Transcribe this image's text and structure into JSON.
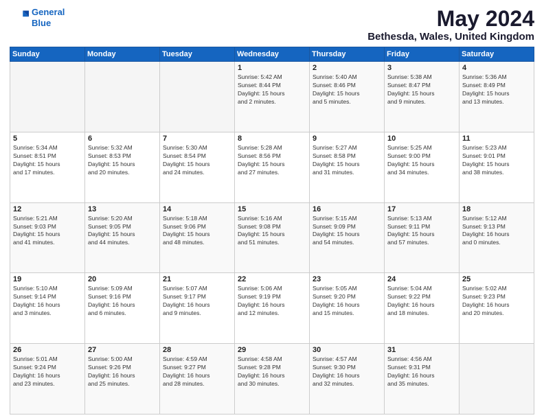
{
  "header": {
    "logo_line1": "General",
    "logo_line2": "Blue",
    "main_title": "May 2024",
    "subtitle": "Bethesda, Wales, United Kingdom"
  },
  "weekdays": [
    "Sunday",
    "Monday",
    "Tuesday",
    "Wednesday",
    "Thursday",
    "Friday",
    "Saturday"
  ],
  "weeks": [
    [
      {
        "day": "",
        "detail": ""
      },
      {
        "day": "",
        "detail": ""
      },
      {
        "day": "",
        "detail": ""
      },
      {
        "day": "1",
        "detail": "Sunrise: 5:42 AM\nSunset: 8:44 PM\nDaylight: 15 hours\nand 2 minutes."
      },
      {
        "day": "2",
        "detail": "Sunrise: 5:40 AM\nSunset: 8:46 PM\nDaylight: 15 hours\nand 5 minutes."
      },
      {
        "day": "3",
        "detail": "Sunrise: 5:38 AM\nSunset: 8:47 PM\nDaylight: 15 hours\nand 9 minutes."
      },
      {
        "day": "4",
        "detail": "Sunrise: 5:36 AM\nSunset: 8:49 PM\nDaylight: 15 hours\nand 13 minutes."
      }
    ],
    [
      {
        "day": "5",
        "detail": "Sunrise: 5:34 AM\nSunset: 8:51 PM\nDaylight: 15 hours\nand 17 minutes."
      },
      {
        "day": "6",
        "detail": "Sunrise: 5:32 AM\nSunset: 8:53 PM\nDaylight: 15 hours\nand 20 minutes."
      },
      {
        "day": "7",
        "detail": "Sunrise: 5:30 AM\nSunset: 8:54 PM\nDaylight: 15 hours\nand 24 minutes."
      },
      {
        "day": "8",
        "detail": "Sunrise: 5:28 AM\nSunset: 8:56 PM\nDaylight: 15 hours\nand 27 minutes."
      },
      {
        "day": "9",
        "detail": "Sunrise: 5:27 AM\nSunset: 8:58 PM\nDaylight: 15 hours\nand 31 minutes."
      },
      {
        "day": "10",
        "detail": "Sunrise: 5:25 AM\nSunset: 9:00 PM\nDaylight: 15 hours\nand 34 minutes."
      },
      {
        "day": "11",
        "detail": "Sunrise: 5:23 AM\nSunset: 9:01 PM\nDaylight: 15 hours\nand 38 minutes."
      }
    ],
    [
      {
        "day": "12",
        "detail": "Sunrise: 5:21 AM\nSunset: 9:03 PM\nDaylight: 15 hours\nand 41 minutes."
      },
      {
        "day": "13",
        "detail": "Sunrise: 5:20 AM\nSunset: 9:05 PM\nDaylight: 15 hours\nand 44 minutes."
      },
      {
        "day": "14",
        "detail": "Sunrise: 5:18 AM\nSunset: 9:06 PM\nDaylight: 15 hours\nand 48 minutes."
      },
      {
        "day": "15",
        "detail": "Sunrise: 5:16 AM\nSunset: 9:08 PM\nDaylight: 15 hours\nand 51 minutes."
      },
      {
        "day": "16",
        "detail": "Sunrise: 5:15 AM\nSunset: 9:09 PM\nDaylight: 15 hours\nand 54 minutes."
      },
      {
        "day": "17",
        "detail": "Sunrise: 5:13 AM\nSunset: 9:11 PM\nDaylight: 15 hours\nand 57 minutes."
      },
      {
        "day": "18",
        "detail": "Sunrise: 5:12 AM\nSunset: 9:13 PM\nDaylight: 16 hours\nand 0 minutes."
      }
    ],
    [
      {
        "day": "19",
        "detail": "Sunrise: 5:10 AM\nSunset: 9:14 PM\nDaylight: 16 hours\nand 3 minutes."
      },
      {
        "day": "20",
        "detail": "Sunrise: 5:09 AM\nSunset: 9:16 PM\nDaylight: 16 hours\nand 6 minutes."
      },
      {
        "day": "21",
        "detail": "Sunrise: 5:07 AM\nSunset: 9:17 PM\nDaylight: 16 hours\nand 9 minutes."
      },
      {
        "day": "22",
        "detail": "Sunrise: 5:06 AM\nSunset: 9:19 PM\nDaylight: 16 hours\nand 12 minutes."
      },
      {
        "day": "23",
        "detail": "Sunrise: 5:05 AM\nSunset: 9:20 PM\nDaylight: 16 hours\nand 15 minutes."
      },
      {
        "day": "24",
        "detail": "Sunrise: 5:04 AM\nSunset: 9:22 PM\nDaylight: 16 hours\nand 18 minutes."
      },
      {
        "day": "25",
        "detail": "Sunrise: 5:02 AM\nSunset: 9:23 PM\nDaylight: 16 hours\nand 20 minutes."
      }
    ],
    [
      {
        "day": "26",
        "detail": "Sunrise: 5:01 AM\nSunset: 9:24 PM\nDaylight: 16 hours\nand 23 minutes."
      },
      {
        "day": "27",
        "detail": "Sunrise: 5:00 AM\nSunset: 9:26 PM\nDaylight: 16 hours\nand 25 minutes."
      },
      {
        "day": "28",
        "detail": "Sunrise: 4:59 AM\nSunset: 9:27 PM\nDaylight: 16 hours\nand 28 minutes."
      },
      {
        "day": "29",
        "detail": "Sunrise: 4:58 AM\nSunset: 9:28 PM\nDaylight: 16 hours\nand 30 minutes."
      },
      {
        "day": "30",
        "detail": "Sunrise: 4:57 AM\nSunset: 9:30 PM\nDaylight: 16 hours\nand 32 minutes."
      },
      {
        "day": "31",
        "detail": "Sunrise: 4:56 AM\nSunset: 9:31 PM\nDaylight: 16 hours\nand 35 minutes."
      },
      {
        "day": "",
        "detail": ""
      }
    ]
  ]
}
